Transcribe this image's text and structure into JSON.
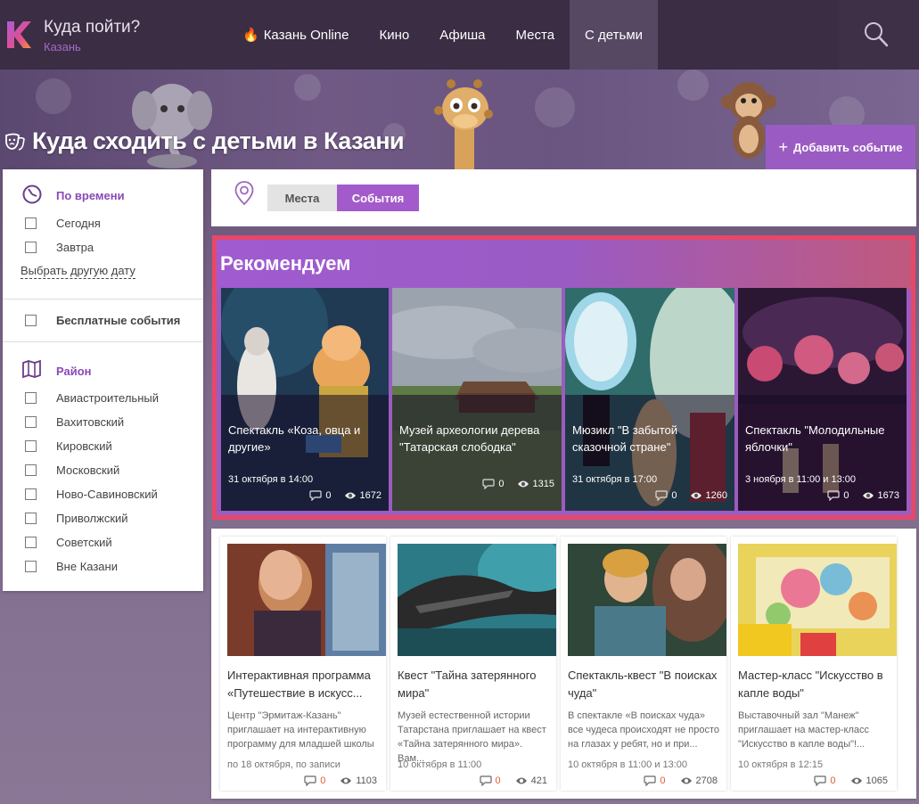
{
  "header": {
    "site_title": "Куда пойти?",
    "city": "Казань",
    "nav": [
      {
        "label": "Казань Online",
        "icon": "fire-icon"
      },
      {
        "label": "Кино"
      },
      {
        "label": "Афиша"
      },
      {
        "label": "Места"
      },
      {
        "label": "С детьми",
        "active": true
      }
    ],
    "search_icon": "search-icon"
  },
  "hero": {
    "title": "Куда сходить с детьми в Казани",
    "add_button": "Добавить событие"
  },
  "sidebar": {
    "time_title": "По времени",
    "time_options": [
      "Сегодня",
      "Завтра"
    ],
    "other_date": "Выбрать другую дату",
    "free_events": "Бесплатные события",
    "district_title": "Район",
    "districts": [
      "Авиастроительный",
      "Вахитовский",
      "Кировский",
      "Московский",
      "Ново-Савиновский",
      "Приволжский",
      "Советский",
      "Вне Казани"
    ]
  },
  "toggle": {
    "places": "Места",
    "events": "События"
  },
  "recommended": {
    "title": "Рекомендуем",
    "cards": [
      {
        "title": "Спектакль «Коза, овца и другие»",
        "date": "31 октября в 14:00",
        "comments": "0",
        "views": "1672"
      },
      {
        "title": "Музей археологии дерева \"Татарская слободка\"",
        "date": "",
        "comments": "0",
        "views": "1315"
      },
      {
        "title": "Мюзикл \"В забытой сказочной стране\"",
        "date": "31 октября в 17:00",
        "comments": "0",
        "views": "1260"
      },
      {
        "title": "Спектакль \"Молодильные яблочки\"",
        "date": "3 ноября в 11:00 и 13:00",
        "comments": "0",
        "views": "1673"
      }
    ]
  },
  "events": [
    {
      "title": "Интерактивная программа «Путешествие в искусс...",
      "desc": "Центр \"Эрмитаж-Казань\" приглашает на интерактивную программу для младшей школы",
      "date": "по 18 октября, по записи",
      "comments": "0",
      "views": "1103"
    },
    {
      "title": "Квест \"Тайна затерянного мира\"",
      "desc": "Музей естественной истории Татарстана приглашает на квест «Тайна затерянного мира». Вам...",
      "date": "10 октября в 11:00",
      "comments": "0",
      "views": "421"
    },
    {
      "title": "Спектакль-квест \"В поисках чуда\"",
      "desc": "В спектакле «В поисках чуда» все чудеса происходят не просто на глазах у ребят, но и при...",
      "date": "10 октября в 11:00 и 13:00",
      "comments": "0",
      "views": "2708"
    },
    {
      "title": "Мастер-класс \"Искусство в капле воды\"",
      "desc": "Выставочный зал \"Манеж\" приглашает на мастер-класс \"Искусство в капле воды\"!...",
      "date": "10 октября в 12:15",
      "comments": "0",
      "views": "1065"
    }
  ]
}
